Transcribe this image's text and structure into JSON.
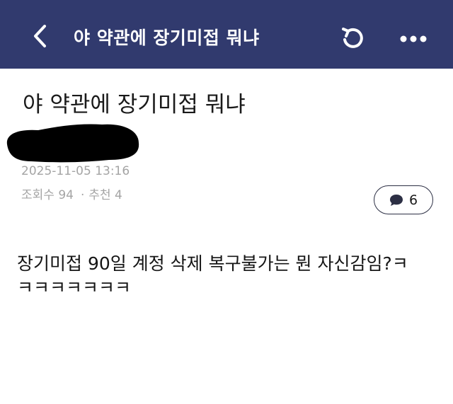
{
  "header": {
    "title": "야 약관에 장기미접 뭐냐",
    "bg_color": "#313a6e"
  },
  "post": {
    "title": "야 약관에 장기미접 뭐냐",
    "date": "2025-11-05 13:16",
    "views": "조회수 94",
    "recommends": "추천 4",
    "comment_count": "6",
    "body_line1": "장기미접 90일 계정 삭제 복구불가는 뭔 자신감임?ㅋ",
    "body_line2": "ㅋㅋㅋㅋㅋㅋㅋ"
  },
  "icons": {
    "back": "chevron-left-icon",
    "refresh": "refresh-icon",
    "more": "more-dots-icon",
    "comment": "speech-bubble-icon"
  }
}
